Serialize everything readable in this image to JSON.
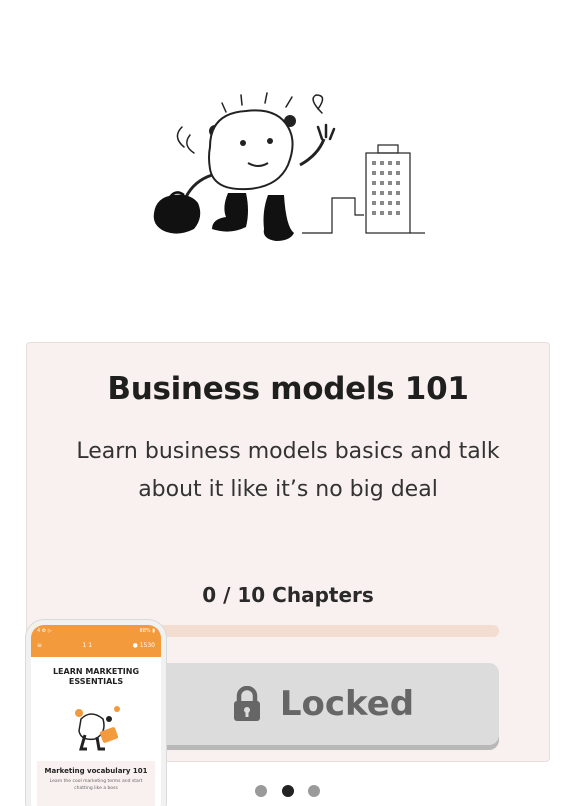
{
  "course": {
    "title": "Business models 101",
    "description": "Learn business models basics and talk about it like it’s no big deal",
    "chapters_label": "0 / 10 Chapters",
    "progress_fraction": 0,
    "locked_label": "Locked"
  },
  "pager": {
    "count": 3,
    "active_index": 1
  },
  "phone_preview": {
    "status_left": "4 ⚙ ▷",
    "status_right": "88% ▮",
    "bar_left": "≡",
    "bar_mid": "1  1",
    "bar_right": "● 1530",
    "heading": "LEARN MARKETING ESSENTIALS",
    "card_title": "Marketing vocabulary 101",
    "card_desc": "Learn the cool marketing terms and start chatting like a boss"
  },
  "colors": {
    "accent": "#f08a3a",
    "card_bg": "#f8f1ef",
    "locked_bg": "#dcdcdc",
    "dot_active": "#222222",
    "dot_inactive": "#9a9a9a"
  },
  "icons": {
    "lock": "lock-icon",
    "hero": "mascot-walking-illustration"
  }
}
